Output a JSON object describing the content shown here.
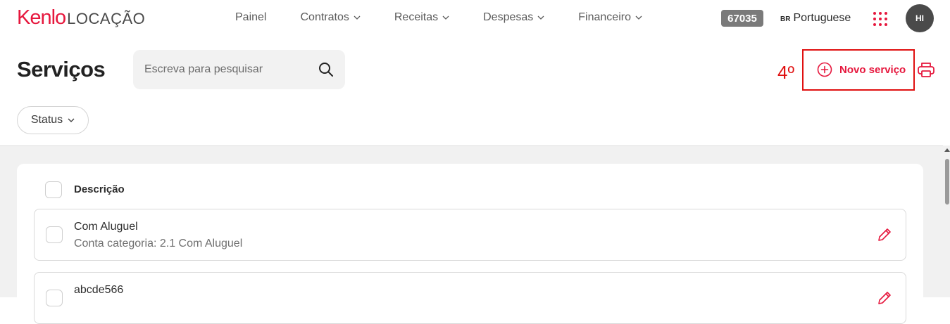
{
  "app": {
    "brand_name": "Kenlo",
    "product_name": "LOCAÇÃO"
  },
  "nav": {
    "items": [
      {
        "label": "Painel",
        "has_dropdown": false
      },
      {
        "label": "Contratos",
        "has_dropdown": true
      },
      {
        "label": "Receitas",
        "has_dropdown": true
      },
      {
        "label": "Despesas",
        "has_dropdown": true
      },
      {
        "label": "Financeiro",
        "has_dropdown": true
      }
    ],
    "account_badge": "67035",
    "language_code": "BR",
    "language_label": "Portuguese",
    "apps_icon": "grid-dots-icon",
    "user_initials": "HI"
  },
  "page": {
    "title": "Serviços",
    "search_placeholder": "Escreva para pesquisar",
    "annotation": "4º",
    "new_button_label": "Novo serviço",
    "print_icon": "printer-icon",
    "status_filter_label": "Status"
  },
  "table": {
    "header_label": "Descrição",
    "rows": [
      {
        "title": "Com Aluguel",
        "subtitle": "Conta categoria: 2.1 Com Aluguel"
      },
      {
        "title": "abcde566",
        "subtitle": ""
      }
    ]
  },
  "colors": {
    "brand": "#e6173d",
    "annotation": "#e01010",
    "badge": "#7a7a7a"
  }
}
